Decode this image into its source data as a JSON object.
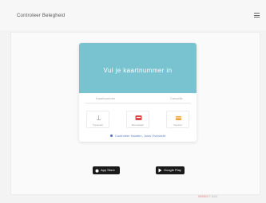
{
  "header": {
    "title": "Controleer Belegheid"
  },
  "card": {
    "heading": "Vul je kaartnummer in",
    "input_placeholder": "Kaartnummer",
    "input_hint": "Cancelle",
    "options": [
      {
        "label": "Typecode",
        "icon": "scale-icon"
      },
      {
        "label": "Bonuskaart",
        "icon": "shop-card-icon"
      },
      {
        "label": "Voucher",
        "icon": "gift-voucher-icon"
      }
    ],
    "help_text": "Controleer Kaarten, Jouw Overzicht"
  },
  "stores": {
    "appstore_label": "App Store",
    "googleplay_label": "Google Play"
  },
  "footer": {
    "brand": "VEKSO",
    "copyright": "© 2021"
  },
  "colors": {
    "card_header": "#79c2cf",
    "link": "#5b7fc4",
    "red_icon": "#d84a4a",
    "orange_icon": "#f0a33a"
  }
}
